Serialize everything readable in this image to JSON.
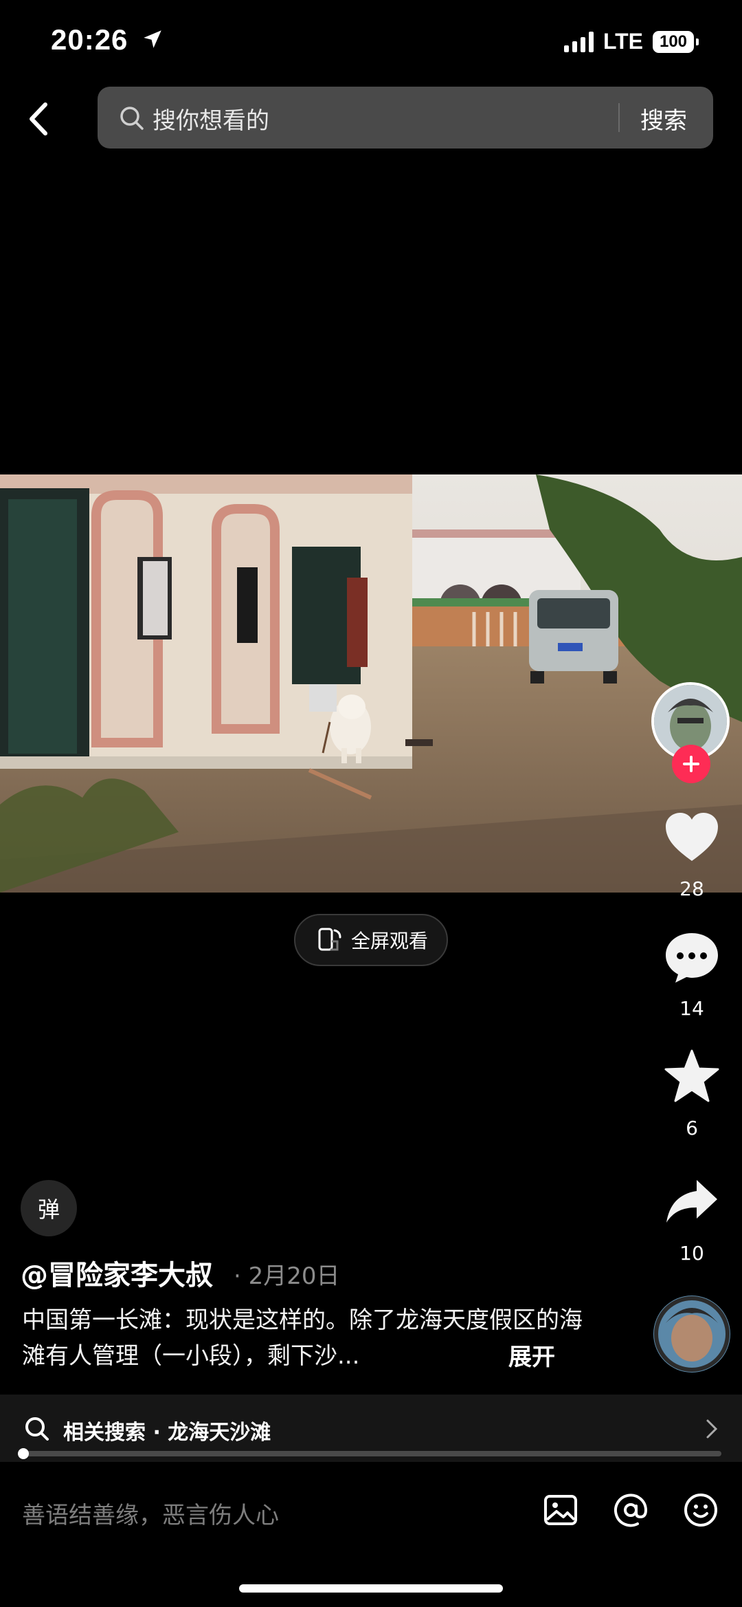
{
  "status_bar": {
    "time": "20:26",
    "network": "LTE",
    "battery": "100"
  },
  "search": {
    "placeholder": "搜你想看的",
    "button": "搜索"
  },
  "video": {
    "fullscreen_label": "全屏观看"
  },
  "actions": {
    "likes": "28",
    "comments": "14",
    "favorites": "6",
    "shares": "10"
  },
  "post": {
    "danmu_label": "弹",
    "author": "@冒险家李大叔",
    "date": "· 2月20日",
    "caption": "中国第一长滩：现状是这样的。除了龙海天度假区的海滩有人管理（一小段），剩下沙...",
    "expand": "展开"
  },
  "related": {
    "text": "相关搜索 · 龙海天沙滩"
  },
  "progress": {
    "fraction": 0.0
  },
  "comment": {
    "placeholder": "善语结善缘，恶言伤人心"
  },
  "colors": {
    "accent": "#fe2c55",
    "background": "#000000"
  },
  "icons": [
    "location-arrow-icon",
    "signal-icon",
    "back-icon",
    "search-icon",
    "fullscreen-icon",
    "plus-icon",
    "heart-icon",
    "comment-icon",
    "star-icon",
    "share-icon",
    "chevron-right-icon",
    "image-icon",
    "mention-icon",
    "emoji-icon"
  ]
}
